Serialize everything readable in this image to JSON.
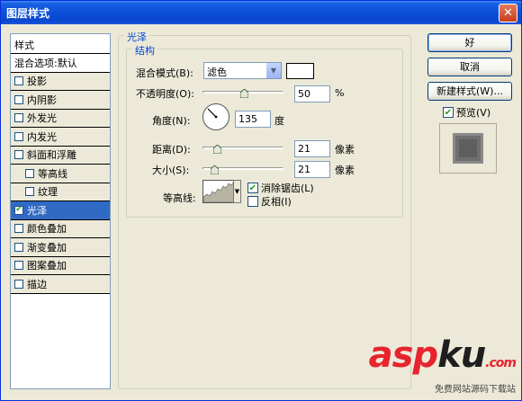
{
  "window": {
    "title": "图层样式",
    "close_glyph": "✕"
  },
  "sidebar": {
    "header": "样式",
    "items": [
      {
        "label": "混合选项:默认",
        "has_checkbox": false,
        "checked": false,
        "sub": false,
        "selected": false
      },
      {
        "label": "投影",
        "has_checkbox": true,
        "checked": false,
        "sub": false,
        "selected": false
      },
      {
        "label": "内阴影",
        "has_checkbox": true,
        "checked": false,
        "sub": false,
        "selected": false
      },
      {
        "label": "外发光",
        "has_checkbox": true,
        "checked": false,
        "sub": false,
        "selected": false
      },
      {
        "label": "内发光",
        "has_checkbox": true,
        "checked": false,
        "sub": false,
        "selected": false
      },
      {
        "label": "斜面和浮雕",
        "has_checkbox": true,
        "checked": false,
        "sub": false,
        "selected": false
      },
      {
        "label": "等高线",
        "has_checkbox": true,
        "checked": false,
        "sub": true,
        "selected": false
      },
      {
        "label": "纹理",
        "has_checkbox": true,
        "checked": false,
        "sub": true,
        "selected": false
      },
      {
        "label": "光泽",
        "has_checkbox": true,
        "checked": true,
        "sub": false,
        "selected": true
      },
      {
        "label": "颜色叠加",
        "has_checkbox": true,
        "checked": false,
        "sub": false,
        "selected": false
      },
      {
        "label": "渐变叠加",
        "has_checkbox": true,
        "checked": false,
        "sub": false,
        "selected": false
      },
      {
        "label": "图案叠加",
        "has_checkbox": true,
        "checked": false,
        "sub": false,
        "selected": false
      },
      {
        "label": "描边",
        "has_checkbox": true,
        "checked": false,
        "sub": false,
        "selected": false
      }
    ]
  },
  "satin": {
    "group_title": "光泽",
    "structure_title": "结构",
    "blend_mode_label": "混合模式(B):",
    "blend_mode_value": "滤色",
    "color": "#ffffff",
    "opacity_label": "不透明度(O):",
    "opacity_value": "50",
    "opacity_unit": "%",
    "angle_label": "角度(N):",
    "angle_value": "135",
    "angle_unit": "度",
    "distance_label": "距离(D):",
    "distance_value": "21",
    "distance_unit": "像素",
    "size_label": "大小(S):",
    "size_value": "21",
    "size_unit": "像素",
    "contour_label": "等高线:",
    "antialias_label": "消除锯齿(L)",
    "antialias_checked": true,
    "invert_label": "反相(I)",
    "invert_checked": false
  },
  "buttons": {
    "ok": "好",
    "cancel": "取消",
    "new_style": "新建样式(W)..."
  },
  "preview": {
    "label": "预览(V)",
    "checked": true
  },
  "watermark": {
    "brand_red": "asp",
    "brand_dark": "ku",
    "tail": ".com",
    "sub": "免费网站源码下载站"
  },
  "colors": {
    "selected": "#316ac5",
    "check": "#21a121",
    "group_title": "#0046d5",
    "brand": "#e8232d"
  }
}
